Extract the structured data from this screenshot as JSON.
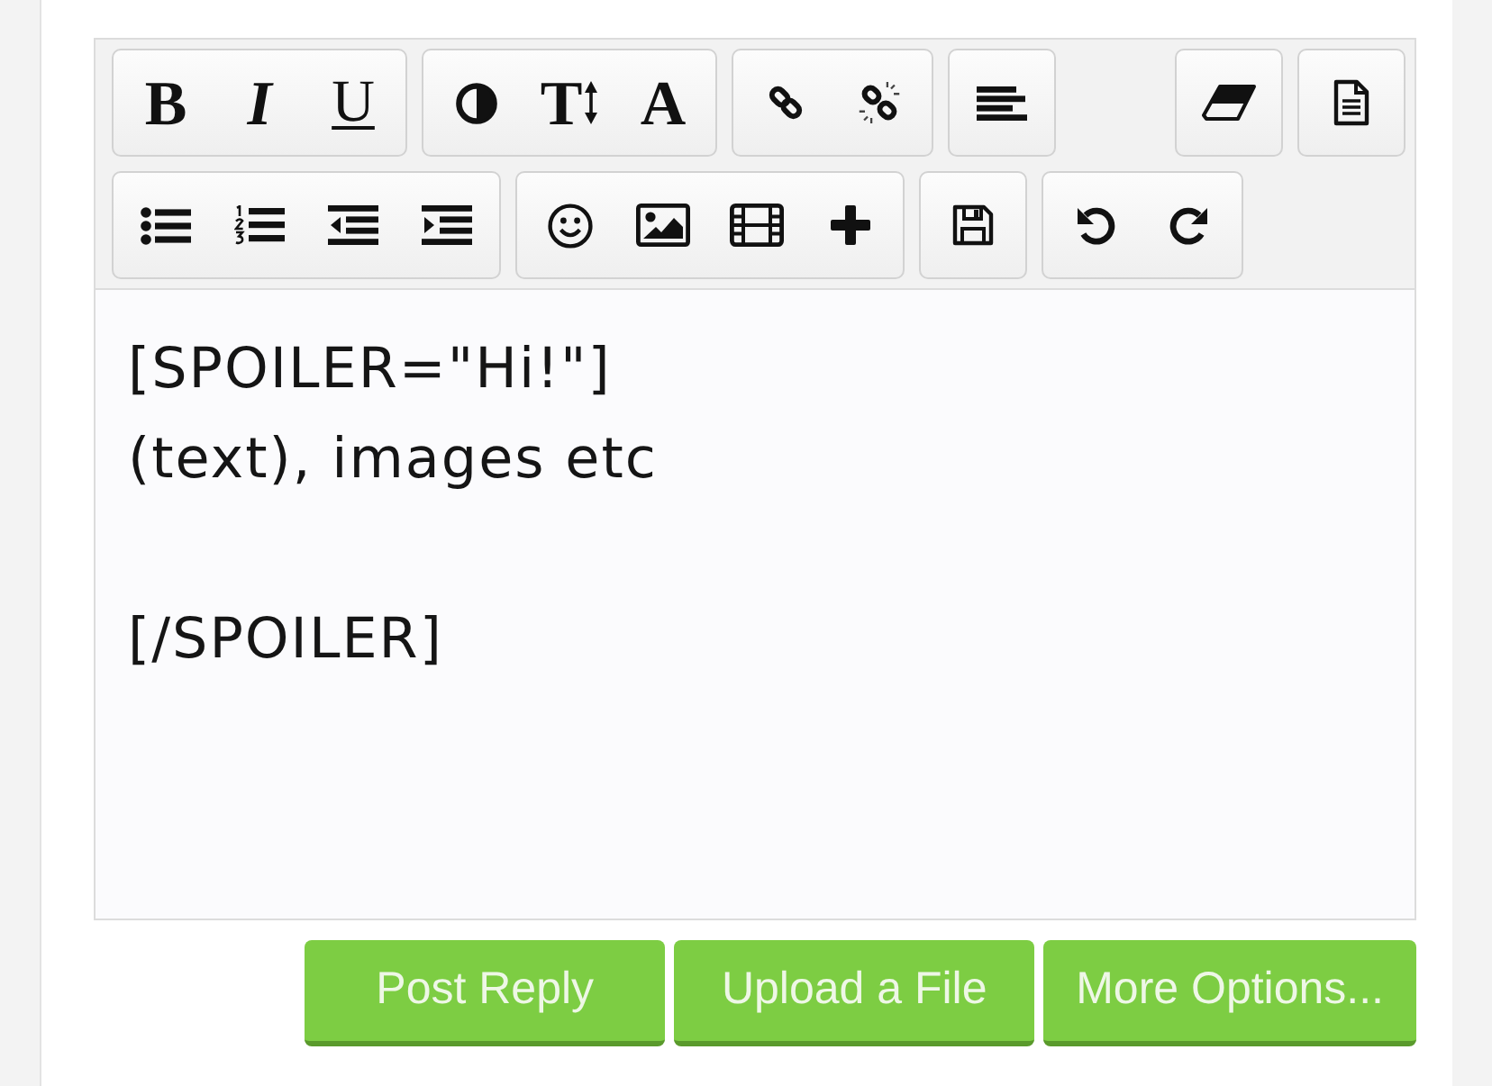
{
  "toolbar": {
    "rows": [
      {
        "groups": [
          {
            "buttons": [
              {
                "kind": "bold",
                "label": "B"
              },
              {
                "kind": "italic",
                "label": "I"
              },
              {
                "kind": "underline",
                "label": "U"
              }
            ]
          },
          {
            "buttons": [
              {
                "kind": "contrast"
              },
              {
                "kind": "textsize",
                "label": "T"
              },
              {
                "kind": "font",
                "label": "A"
              }
            ]
          },
          {
            "buttons": [
              {
                "kind": "link"
              },
              {
                "kind": "unlink"
              }
            ]
          },
          {
            "buttons": [
              {
                "kind": "align"
              }
            ]
          }
        ],
        "end_groups": [
          {
            "buttons": [
              {
                "kind": "eraser"
              }
            ]
          },
          {
            "buttons": [
              {
                "kind": "document"
              }
            ]
          }
        ]
      },
      {
        "groups": [
          {
            "buttons": [
              {
                "kind": "bullets"
              },
              {
                "kind": "numbers"
              },
              {
                "kind": "outdent"
              },
              {
                "kind": "indent"
              }
            ]
          },
          {
            "buttons": [
              {
                "kind": "smiley"
              },
              {
                "kind": "image"
              },
              {
                "kind": "video"
              },
              {
                "kind": "plus"
              }
            ]
          },
          {
            "buttons": [
              {
                "kind": "save"
              }
            ]
          },
          {
            "buttons": [
              {
                "kind": "undo"
              },
              {
                "kind": "redo"
              }
            ]
          }
        ]
      }
    ]
  },
  "editor": {
    "value": "[SPOILER=\"Hi!\"]\n(text), images etc\n\n[/SPOILER]"
  },
  "actions": [
    {
      "label": "Post Reply"
    },
    {
      "label": "Upload a File"
    },
    {
      "label": "More Options..."
    }
  ]
}
